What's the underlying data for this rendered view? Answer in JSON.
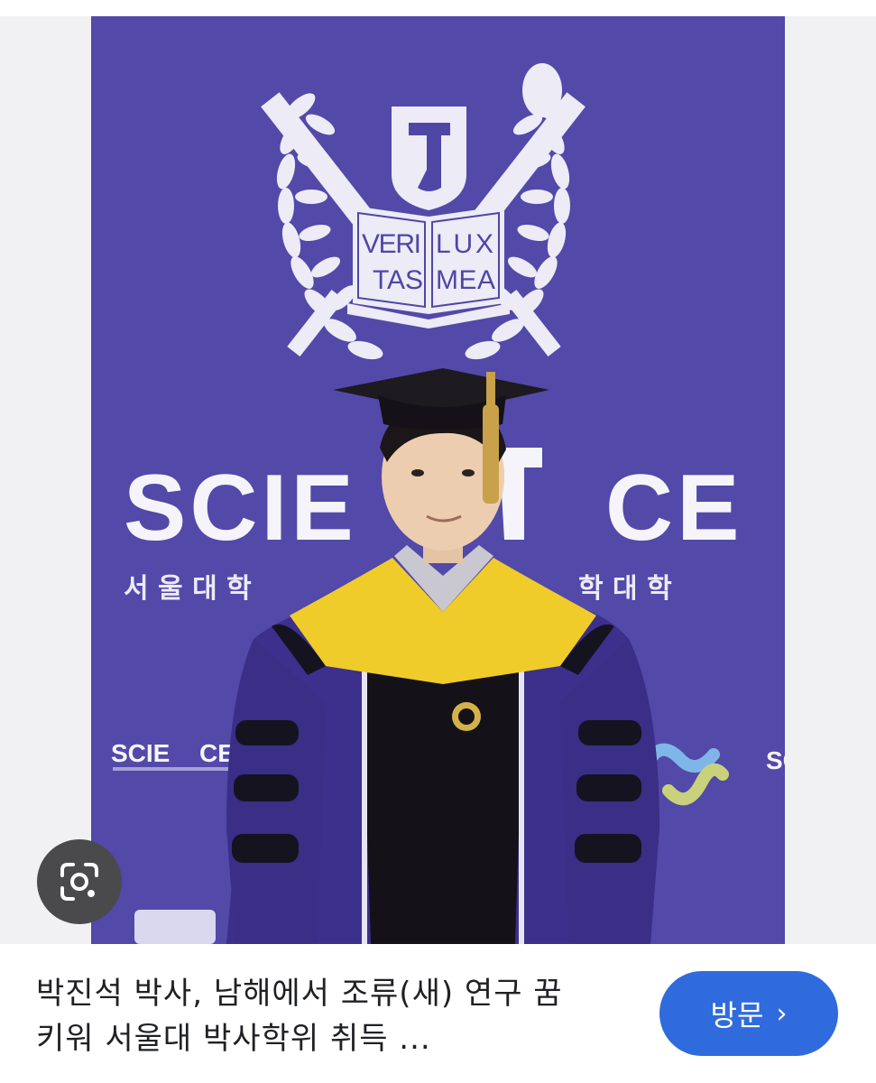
{
  "image": {
    "emblem_text": [
      "VERI",
      "LUX",
      "TAS",
      "MEA"
    ],
    "banner_word": "SCIE",
    "banner_word_end": "CE",
    "banner_subtitle_left": "서 울 대 학",
    "banner_subtitle_right": "학 대 학",
    "small_logo_left": "SCIE",
    "small_logo_left_end": "CE",
    "small_logo_right": "SC"
  },
  "lens": {
    "icon": "google-lens-icon"
  },
  "result": {
    "title_line1": "박진석 박사, 남해에서 조류(새) 연구 꿈",
    "title_line2": "키워 서울대 박사학위 취득 ...",
    "visit_label": "방문",
    "visit_icon": "chevron-right-icon"
  },
  "colors": {
    "backdrop": "#4f46a6",
    "gown": "#3d2f8c",
    "hood": "#f0cc2a",
    "visit_button": "#2f6bdc",
    "lens_button": "#4a4a4c"
  }
}
